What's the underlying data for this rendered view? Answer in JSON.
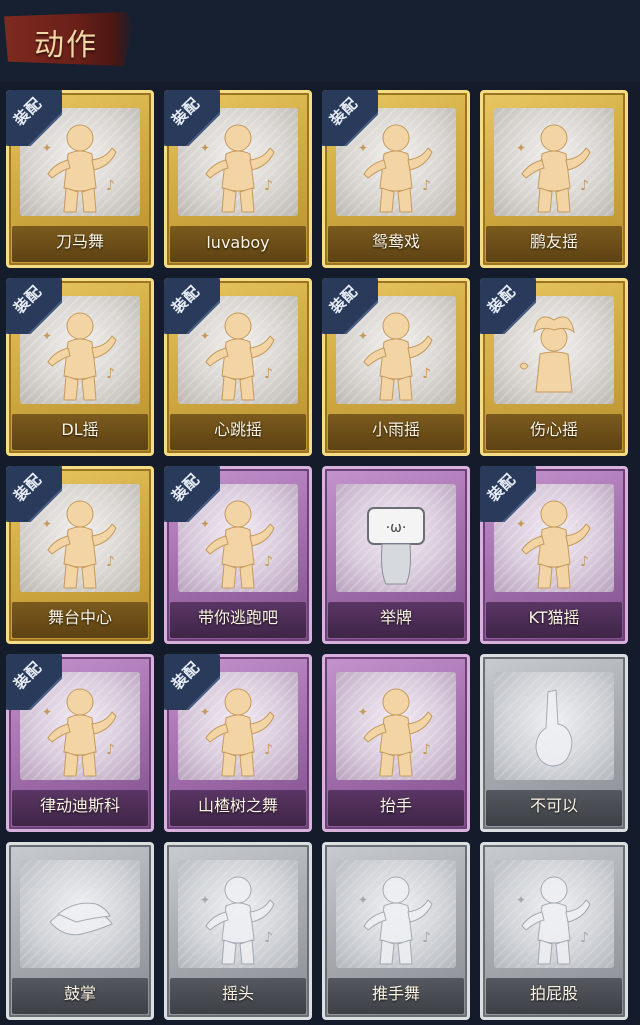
{
  "header": {
    "title": "动作"
  },
  "equip_label": "装配",
  "colors": {
    "gold": "#d3ad45",
    "purple": "#a672b0",
    "grey": "#a9adb2",
    "figure": "#f3d4a5"
  },
  "actions": [
    {
      "label": "刀马舞",
      "tier": "gold",
      "equipped": true,
      "icon": "dance-figure-icon"
    },
    {
      "label": "luvaboy",
      "tier": "gold",
      "equipped": true,
      "icon": "dance-figure-icon"
    },
    {
      "label": "鸳鸯戏",
      "tier": "gold",
      "equipped": true,
      "icon": "dance-figure-icon"
    },
    {
      "label": "鹏友摇",
      "tier": "gold",
      "equipped": false,
      "icon": "dance-figure-icon"
    },
    {
      "label": "DL摇",
      "tier": "gold",
      "equipped": true,
      "icon": "dance-figure-icon"
    },
    {
      "label": "心跳摇",
      "tier": "gold",
      "equipped": true,
      "icon": "dance-figure-icon"
    },
    {
      "label": "小雨摇",
      "tier": "gold",
      "equipped": true,
      "icon": "dance-figure-icon"
    },
    {
      "label": "伤心摇",
      "tier": "gold",
      "equipped": true,
      "icon": "heart-hands-figure-icon"
    },
    {
      "label": "舞台中心",
      "tier": "gold",
      "equipped": true,
      "icon": "dance-figure-icon"
    },
    {
      "label": "带你逃跑吧",
      "tier": "purple",
      "equipped": true,
      "icon": "dance-figure-icon"
    },
    {
      "label": "举牌",
      "tier": "purple",
      "equipped": false,
      "icon": "sign-holding-figure-icon"
    },
    {
      "label": "KT猫摇",
      "tier": "purple",
      "equipped": true,
      "icon": "dance-figure-icon"
    },
    {
      "label": "律动迪斯科",
      "tier": "purple",
      "equipped": true,
      "icon": "disco-figure-icon"
    },
    {
      "label": "山楂树之舞",
      "tier": "purple",
      "equipped": true,
      "icon": "dance-figure-icon"
    },
    {
      "label": "抬手",
      "tier": "purple",
      "equipped": false,
      "icon": "raise-hand-figure-icon"
    },
    {
      "label": "不可以",
      "tier": "grey",
      "equipped": false,
      "icon": "finger-wag-icon"
    },
    {
      "label": "鼓掌",
      "tier": "grey",
      "equipped": false,
      "icon": "clapping-hands-icon"
    },
    {
      "label": "摇头",
      "tier": "grey",
      "equipped": false,
      "icon": "head-shake-figure-icon"
    },
    {
      "label": "推手舞",
      "tier": "grey",
      "equipped": false,
      "icon": "push-hands-figure-icon"
    },
    {
      "label": "拍屁股",
      "tier": "grey",
      "equipped": false,
      "icon": "butt-slap-figure-icon"
    }
  ]
}
